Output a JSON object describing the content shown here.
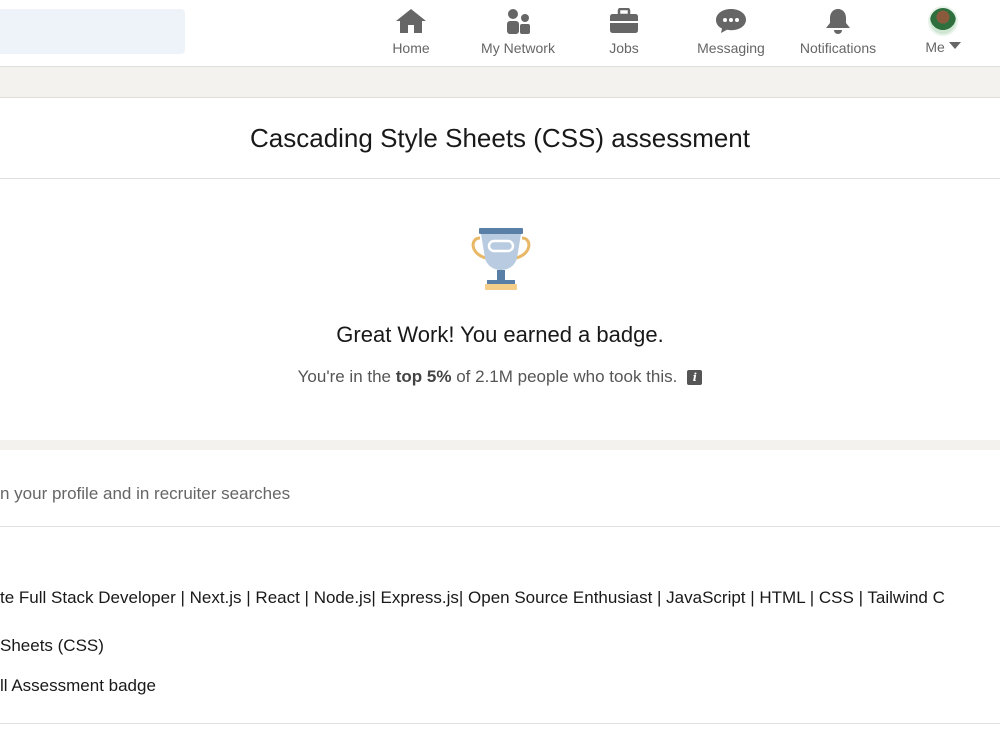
{
  "nav": {
    "items": [
      {
        "label": "Home",
        "icon": "home-icon"
      },
      {
        "label": "My Network",
        "icon": "network-icon"
      },
      {
        "label": "Jobs",
        "icon": "briefcase-icon"
      },
      {
        "label": "Messaging",
        "icon": "messaging-icon"
      },
      {
        "label": "Notifications",
        "icon": "bell-icon"
      },
      {
        "label": "Me",
        "icon": "avatar"
      }
    ]
  },
  "assessment": {
    "title": "Cascading Style Sheets (CSS) assessment",
    "headline": "Great Work! You earned a badge.",
    "sub_prefix": "You're in the ",
    "sub_bold": "top 5%",
    "sub_suffix": " of 2.1M people who took this.",
    "badge_icon": "trophy-icon"
  },
  "details": {
    "note": "n your profile and in recruiter searches",
    "headline_text": "te Full Stack Developer | Next.js | React | Node.js| Express.js| Open Source Enthusiast | JavaScript | HTML | CSS | Tailwind C",
    "skill": "Sheets (CSS)",
    "badge_text": "ll Assessment badge"
  },
  "colors": {
    "nav_icon": "#666666",
    "page_bg": "#f3f2ef",
    "trophy_cup": "#b8cbe0",
    "trophy_handle": "#e8b866"
  }
}
